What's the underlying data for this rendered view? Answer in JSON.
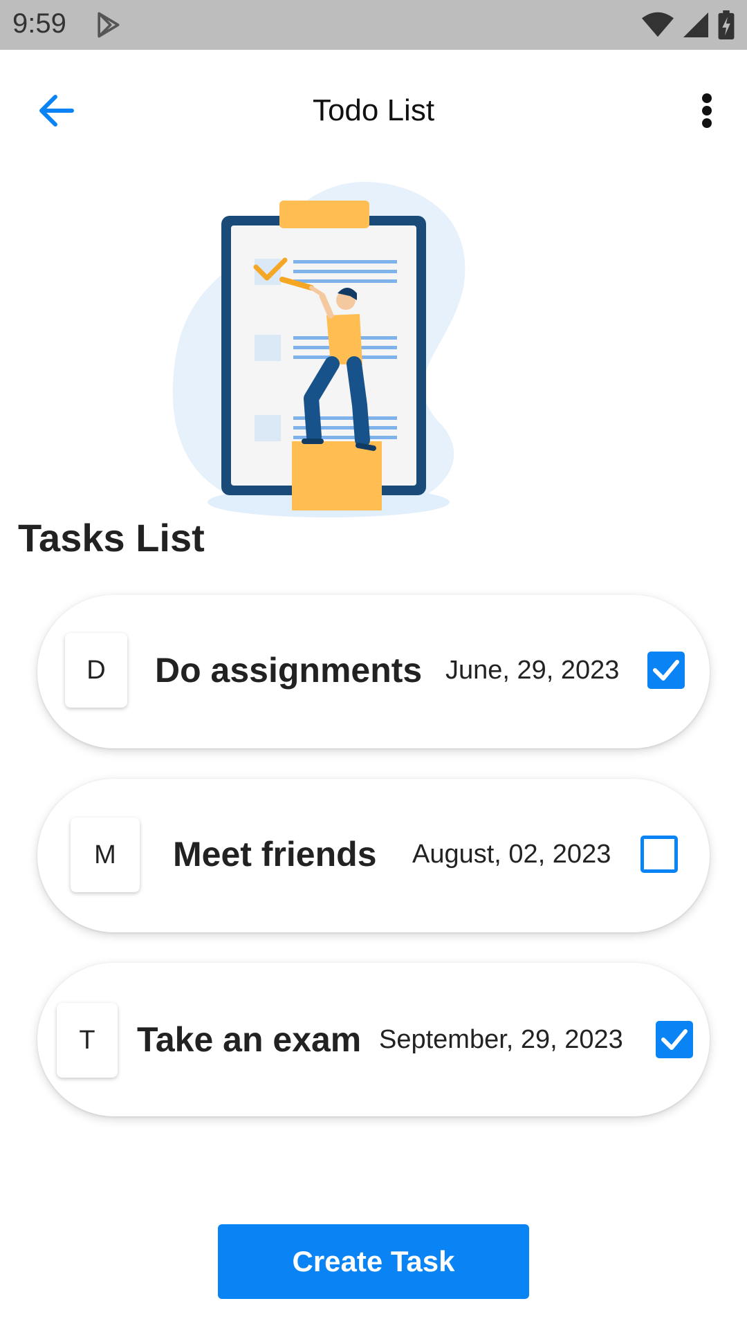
{
  "status_bar": {
    "time": "9:59",
    "icons": [
      "play-store-icon",
      "wifi-icon",
      "cell-signal-icon",
      "battery-charging-icon"
    ]
  },
  "app_bar": {
    "title": "Todo List",
    "back_icon": "arrow-left-icon",
    "menu_icon": "more-vertical-icon"
  },
  "illustration": {
    "name": "clipboard-checklist-illustration"
  },
  "tasks_section": {
    "title": "Tasks List"
  },
  "tasks": [
    {
      "initial": "D",
      "title": "Do assignments",
      "date": "June, 29, 2023",
      "checked": true
    },
    {
      "initial": "M",
      "title": "Meet friends",
      "date": "August, 02, 2023",
      "checked": false
    },
    {
      "initial": "T",
      "title": "Take an exam",
      "date": "September, 29, 2023",
      "checked": true
    }
  ],
  "create_button": {
    "label": "Create Task"
  },
  "colors": {
    "accent": "#0a84f5",
    "status_bar": "#bdbdbd",
    "illustration_navy": "#1a4a78",
    "illustration_yellow": "#ffbd52",
    "illustration_light_blue": "#e6f1fc"
  }
}
